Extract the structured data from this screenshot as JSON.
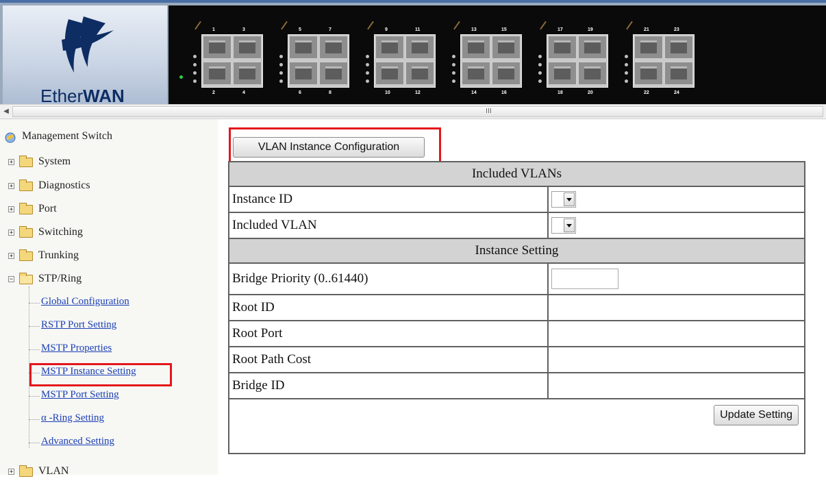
{
  "header": {
    "logo_text_light": "Ether",
    "logo_text_bold": "WAN",
    "port_labels_top": [
      "1",
      "3",
      "5",
      "7",
      "9",
      "11",
      "13",
      "15",
      "17",
      "19",
      "21",
      "23"
    ],
    "port_labels_bottom": [
      "2",
      "4",
      "6",
      "8",
      "10",
      "12",
      "14",
      "16",
      "18",
      "20",
      "22",
      "24"
    ]
  },
  "scrollbar": {
    "left_arrow": "◀",
    "grip": "III"
  },
  "sidebar": {
    "root": "Management Switch",
    "items": [
      {
        "label": "System",
        "expanded": false
      },
      {
        "label": "Diagnostics",
        "expanded": false
      },
      {
        "label": "Port",
        "expanded": false
      },
      {
        "label": "Switching",
        "expanded": false
      },
      {
        "label": "Trunking",
        "expanded": false
      },
      {
        "label": "STP/Ring",
        "expanded": true
      },
      {
        "label": "VLAN",
        "expanded": false
      }
    ],
    "stp_children": [
      "Global Configuration",
      "RSTP Port Setting",
      "MSTP Properties",
      "MSTP Instance Setting",
      "MSTP Port Setting",
      "α -Ring Setting",
      "Advanced Setting"
    ],
    "highlighted": "MSTP Instance Setting"
  },
  "main": {
    "vlan_button": "VLAN Instance Configuration",
    "section_included": "Included VLANs",
    "instance_id_label": "Instance ID",
    "included_vlan_label": "Included VLAN",
    "section_instance": "Instance Setting",
    "bridge_priority_label": "Bridge Priority (0..61440)",
    "bridge_priority_value": "",
    "root_id_label": "Root ID",
    "root_id_value": "",
    "root_port_label": "Root Port",
    "root_port_value": "",
    "root_path_cost_label": "Root Path Cost",
    "root_path_cost_value": "",
    "bridge_id_label": "Bridge ID",
    "bridge_id_value": "",
    "update_button": "Update Setting"
  },
  "colors": {
    "highlight": "#e3161b",
    "link": "#1a3fb5",
    "section_bg": "#d3d3d3"
  }
}
